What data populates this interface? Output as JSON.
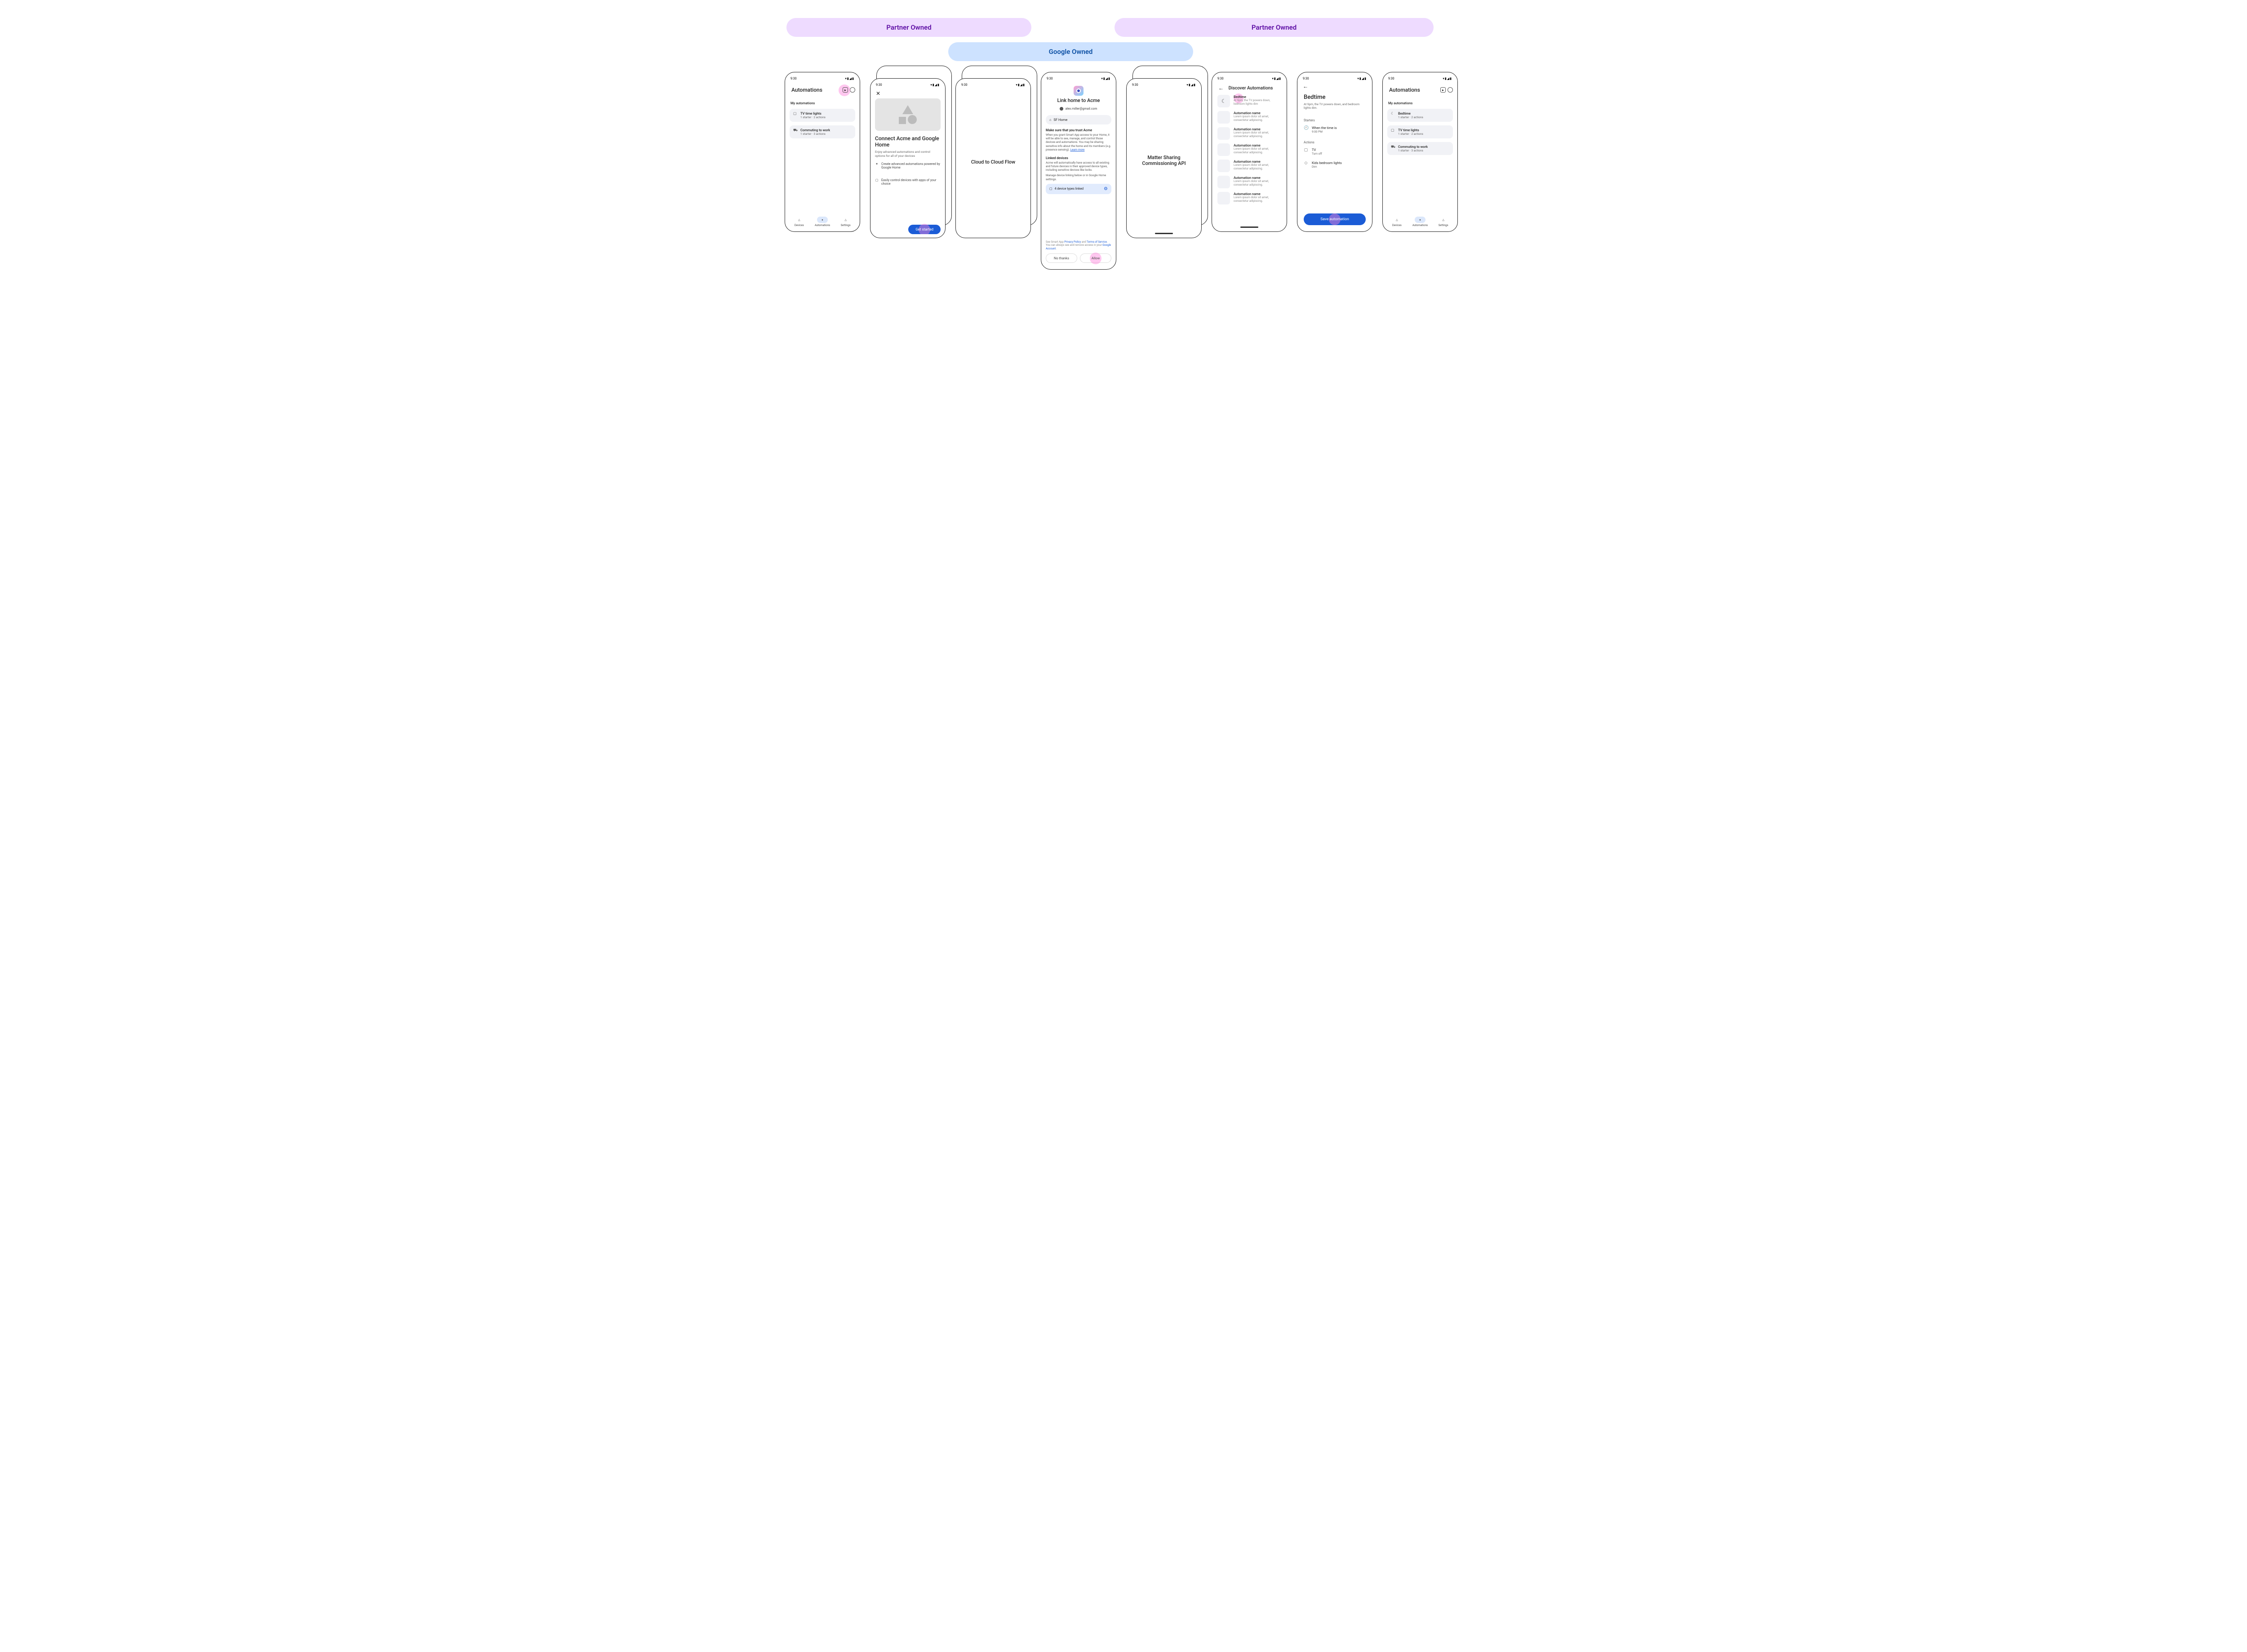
{
  "bars": {
    "partner1": "Partner Owned",
    "partner2": "Partner Owned",
    "google": "Google Owned"
  },
  "status_time": "9:30",
  "nav": {
    "devices": "Devices",
    "automations": "Automations",
    "settings": "Settings"
  },
  "s1": {
    "title": "Automations",
    "section": "My automations",
    "a1_title": "TV time lights",
    "a1_sub": "1 starter · 2 actions",
    "a2_title": "Commuting to work",
    "a2_sub": "1 starter · 3 actions"
  },
  "s2": {
    "title": "Connect Acme and Google Home",
    "body": "Enjoy advanced automations and control options for all of your devices",
    "f1": "Create advanced automations powered by Google Home",
    "f2": "Easily control devices with apps of your choice",
    "cta": "Get started"
  },
  "s3": {
    "title": "Cloud to Cloud Flow"
  },
  "s4": {
    "title": "Link home to Acme",
    "email": "alex.miller@gmail.com",
    "home": "SF Home",
    "trust_h": "Make sure that you trust Acme",
    "trust_p1": "When you grant Smart App access to your Home, it will be able to  see, manage, and control those devices and automations. You may be sharing sensitive info about the home and its members (e.g. presence sensing). ",
    "trust_learn": "Learn more",
    "linked_h": "Linked devices",
    "linked_p": "Acme will automatically have access to all existing and future devices in their approved device types, including sensitive devices like locks.",
    "linked_manage": "Manage device linking below or in Google Home settings.",
    "dev_count": "4 device types linked",
    "footer_a": "See Smart App ",
    "footer_pp": "Privacy Policy",
    "footer_and": " and ",
    "footer_tos": "Terms of Service",
    "footer_b": ". You can always see and remove access in your ",
    "footer_ga": "Google Account",
    "footer_c": ".",
    "no": "No thanks",
    "allow": "Allow"
  },
  "s5": {
    "title": "Matter Sharing Commissioning API"
  },
  "s6": {
    "title": "Discover Automations",
    "bedtime": "Bedtime",
    "bedtime_sub": "At 9pm, the TV powers down, bedroom lights dim",
    "gen_t": "Automation name",
    "gen_s": "Lorem ipsum dolor sit amet, consectetur adipiscing."
  },
  "s7": {
    "title": "Bedtime",
    "sub": "At 9pm, the TV powers down, and bedroom lights dim.",
    "starters": "Starters",
    "st1_t": "When the time is",
    "st1_s": "9:00 PM",
    "actions": "Actions",
    "a1_t": "TV",
    "a1_s": "Turn off",
    "a2_t": "Kids bedroom lights",
    "a2_s": "Dim",
    "save": "Save automation"
  },
  "s8": {
    "title": "Automations",
    "section": "My automations",
    "a1_title": "Bedtime",
    "a1_sub": "1 starter · 2 actions",
    "a2_title": "TV time lights",
    "a2_sub": "1 starter · 2 actions",
    "a3_title": "Commuting to work",
    "a3_sub": "1 starter · 3 actions"
  }
}
